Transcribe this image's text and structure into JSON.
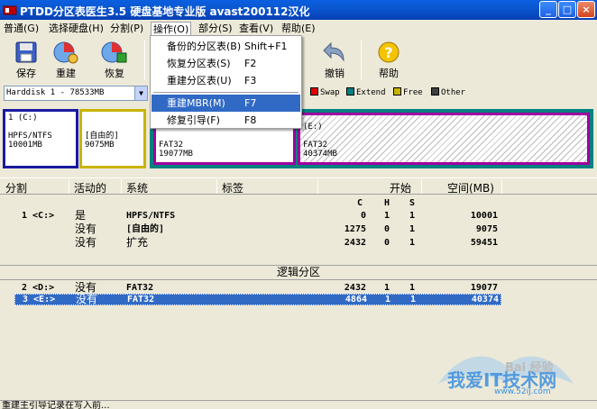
{
  "window": {
    "title": "PTDD分区表医生3.5 硬盘基地专业版 avast200112汉化",
    "minimize": "_",
    "maximize": "□",
    "close": "×"
  },
  "menubar": {
    "items": [
      {
        "label": "普通(G)"
      },
      {
        "label": "选择硬盘(H)"
      },
      {
        "label": "分割(P)"
      },
      {
        "label": "操作(O)"
      },
      {
        "label": "部分(S)"
      },
      {
        "label": "查看(V)"
      },
      {
        "label": "帮助(E)"
      }
    ]
  },
  "toolbar": {
    "save": "保存",
    "rebuild": "重建",
    "restore": "恢复",
    "undo": "撤销",
    "help": "帮助"
  },
  "disk_select": {
    "value": "Harddisk 1 - 78533MB",
    "arrow": "▼"
  },
  "legend": [
    {
      "label": "Swap",
      "color": "#e00000"
    },
    {
      "label": "Extend",
      "color": "#008080"
    },
    {
      "label": "Free",
      "color": "#c8b400"
    },
    {
      "label": "Other",
      "color": "#404040"
    }
  ],
  "diskmap": {
    "c": {
      "line1": "1 (C:)",
      "line2": "HPFS/NTFS",
      "line3": "10001MB"
    },
    "free": {
      "line1": "[自由的]",
      "line2": "9075MB"
    },
    "d": {
      "line1": "FAT32",
      "line2": "19077MB"
    },
    "e": {
      "line1": "(E:)",
      "line2": "FAT32",
      "line3": "40374MB"
    }
  },
  "table": {
    "headers": {
      "partition": "分割",
      "active": "活动的",
      "system": "系统",
      "label": "标签",
      "start": "开始",
      "size": "空间(MB)"
    },
    "chs": {
      "c": "C",
      "h": "H",
      "s": "S"
    },
    "primary_rows": [
      {
        "part": "1 <C:>",
        "active": "是",
        "system": "HPFS/NTFS",
        "c": "0",
        "h": "1",
        "s": "1",
        "size": "10001"
      },
      {
        "part": "",
        "active": "没有",
        "system": "[自由的]",
        "c": "1275",
        "h": "0",
        "s": "1",
        "size": "9075"
      },
      {
        "part": "",
        "active": "没有",
        "system": "扩充",
        "c": "2432",
        "h": "0",
        "s": "1",
        "size": "59451"
      }
    ],
    "logical_section": "逻辑分区",
    "logical_rows": [
      {
        "part": "2 <D:>",
        "active": "没有",
        "system": "FAT32",
        "c": "2432",
        "h": "1",
        "s": "1",
        "size": "19077"
      },
      {
        "part": "3 <E:>",
        "active": "没有",
        "system": "FAT32",
        "c": "4864",
        "h": "1",
        "s": "1",
        "size": "40374"
      }
    ]
  },
  "dropdown": {
    "items": [
      {
        "label": "备份的分区表(B)",
        "shortcut": "Shift+F1"
      },
      {
        "label": "恢复分区表(S)",
        "shortcut": "F2"
      },
      {
        "label": "重建分区表(U)",
        "shortcut": "F3"
      },
      {
        "label": "重建MBR(M)",
        "shortcut": "F7"
      },
      {
        "label": "修复引导(F)",
        "shortcut": "F8"
      }
    ]
  },
  "status": {
    "text": "重建主引导记录在写入前..."
  },
  "watermark": {
    "site": "我爱IT技术网",
    "url": "www.52ij.com",
    "baidu": "Bai 经验"
  },
  "colors": {
    "titlebar": "#0b57d0",
    "selection": "#316ac5",
    "ntfs_border": "#1a1aa0",
    "free_border": "#c8b400",
    "fat32_border": "#a000a0",
    "extend_border": "#008080"
  }
}
